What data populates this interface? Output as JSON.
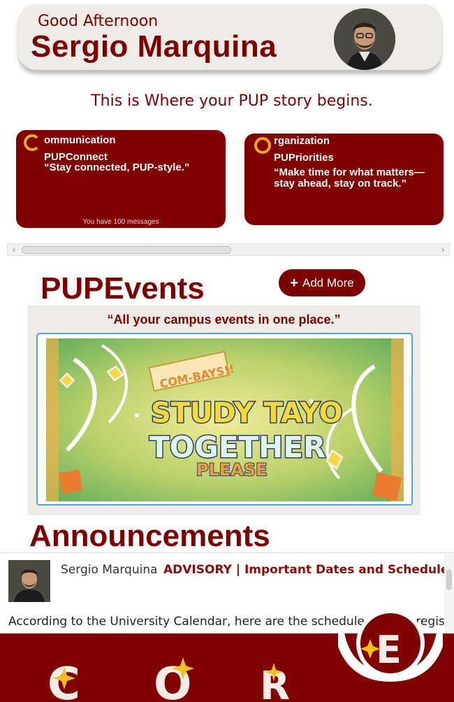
{
  "header": {
    "greeting": "Good Afternoon",
    "user_name": "Sergio Marquina"
  },
  "tagline": "This is Where your PUP story begins.",
  "cards": [
    {
      "letter": "C",
      "title": "ommunication",
      "name": "PUPConnect",
      "quote": "“Stay connected, PUP-style.”",
      "footer": "You have 100 messages"
    },
    {
      "letter": "O",
      "title": "rganization",
      "name": "PUPriorities",
      "quote": "“Make time for what matters—stay ahead, stay on track.”"
    }
  ],
  "events": {
    "title": "PUPEvents",
    "add_more_label": "Add More",
    "quote": "“All your campus events in one place.”",
    "banner": {
      "tag": "COM-BAYS!!",
      "line1": "STUDY TAYO",
      "line2": "TOGETHER",
      "line3": "PLEASE"
    }
  },
  "announcements": {
    "title": "Announcements",
    "items": [
      {
        "author": "Sergio Marquina",
        "heading": "ADVISORY | Important Dates and Schedules for the",
        "body": "According to the University Calendar, here are the scheduled online registration"
      }
    ]
  },
  "bottom_nav": {
    "items": [
      {
        "letter": "C"
      },
      {
        "letter": "O"
      },
      {
        "letter": "R"
      },
      {
        "letter": "E"
      }
    ]
  },
  "colors": {
    "brand": "#800000",
    "accent": "#e8a817",
    "cream": "#efebe6"
  }
}
